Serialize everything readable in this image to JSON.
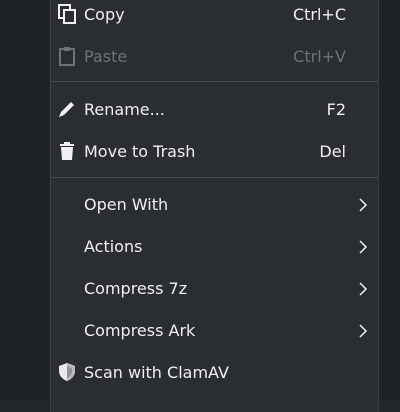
{
  "menu": {
    "items": [
      {
        "label": "Copy",
        "shortcut": "Ctrl+C",
        "icon": "copy-icon"
      },
      {
        "label": "Paste",
        "shortcut": "Ctrl+V",
        "icon": "paste-icon",
        "disabled": true
      },
      {
        "label": "Rename...",
        "shortcut": "F2",
        "icon": "pencil-icon"
      },
      {
        "label": "Move to Trash",
        "shortcut": "Del",
        "icon": "trash-icon"
      },
      {
        "label": "Open With",
        "submenu": true
      },
      {
        "label": "Actions",
        "submenu": true
      },
      {
        "label": "Compress 7z",
        "submenu": true
      },
      {
        "label": "Compress Ark",
        "submenu": true
      },
      {
        "label": "Scan with ClamAV",
        "icon": "shield-icon"
      }
    ]
  },
  "colors": {
    "menu_bg": "#2a2e32",
    "text": "#eff0f1",
    "disabled_text": "#6e7377",
    "separator": "#474c51"
  }
}
